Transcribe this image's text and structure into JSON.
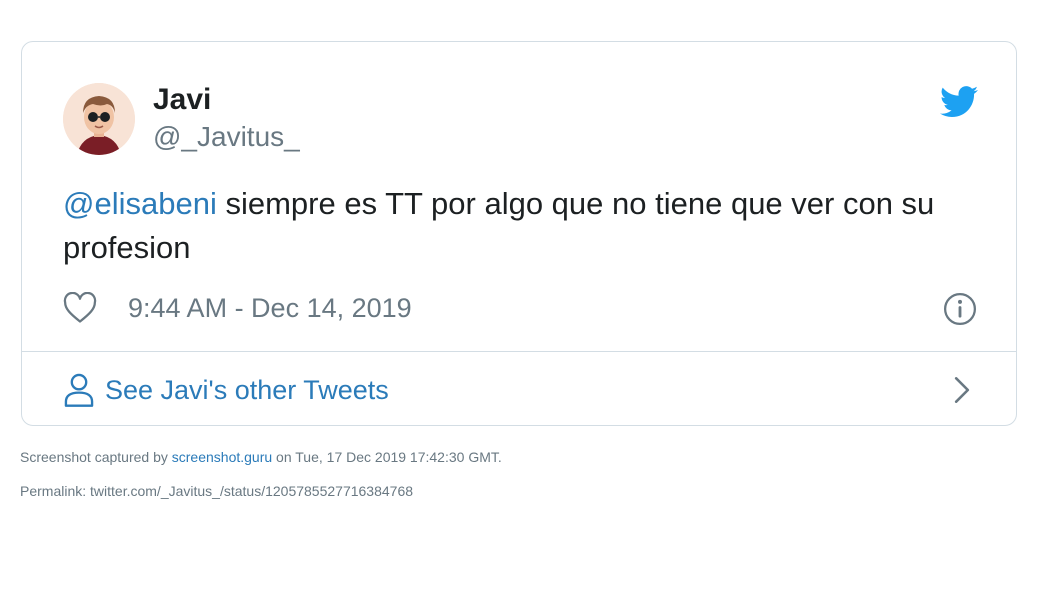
{
  "tweet": {
    "author_name": "Javi",
    "author_handle": "@_Javitus_",
    "mention": "@elisabeni",
    "body": " siempre es TT por algo que no tiene que ver con su profesion",
    "timestamp": "9:44 AM - Dec 14, 2019",
    "more_tweets_label": "See Javi's other Tweets"
  },
  "footer": {
    "captured_prefix": "Screenshot captured by ",
    "captured_link": "screenshot.guru",
    "captured_suffix": " on Tue, 17 Dec 2019 17:42:30 GMT.",
    "permalink": "Permalink: twitter.com/_Javitus_/status/1205785527716384768"
  },
  "icons": {
    "bird": "twitter-bird-icon",
    "heart": "heart-icon",
    "info": "info-icon",
    "person": "person-icon",
    "chevron": "chevron-right-icon"
  },
  "colors": {
    "link": "#2b7bb9",
    "twitter_blue": "#1da1f2",
    "muted": "#697882",
    "border": "#d3dde4"
  }
}
